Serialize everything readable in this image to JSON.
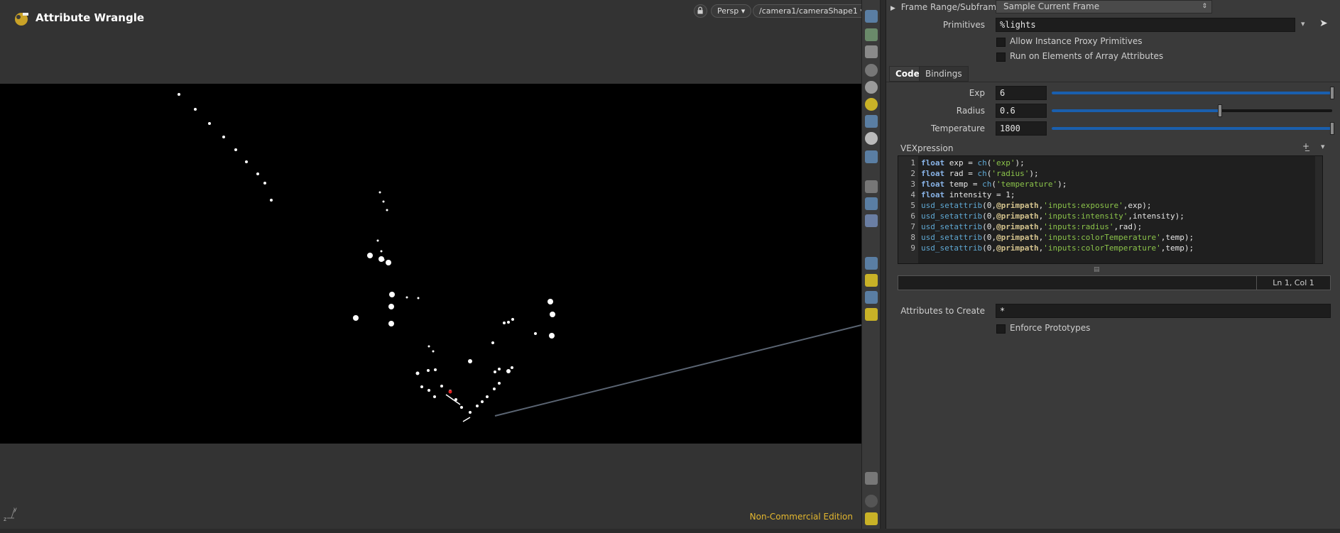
{
  "viewport": {
    "title": "Attribute Wrangle",
    "view_mode": "Persp",
    "camera_path": "/camera1/cameraShape1",
    "edition_badge": "Non-Commercial Edition",
    "icons": [
      "node-logo-icon",
      "lock-icon",
      "axis-gizmo-icon"
    ]
  },
  "toolbar": {
    "icons": [
      "select-icon",
      "transform-icon",
      "lock-icon",
      "close-icon",
      "sphere-icon",
      "light-icon",
      "camera-icon",
      "render-icon",
      "pose-icon",
      "display-icon",
      "info-icon",
      "grid-icon"
    ]
  },
  "panel": {
    "frame_range_label": "Frame Range/Subframes",
    "frame_range_value": "Sample Current Frame",
    "primitives_label": "Primitives",
    "primitives_value": "%lights",
    "allow_instance_label": "Allow Instance Proxy Primitives",
    "run_on_elements_label": "Run on Elements of Array Attributes",
    "tabs": [
      {
        "label": "Code",
        "active": true
      },
      {
        "label": "Bindings",
        "active": false
      }
    ],
    "params": [
      {
        "label": "Exp",
        "value": "6",
        "fraction": 1.0
      },
      {
        "label": "Radius",
        "value": "0.6",
        "fraction": 0.6
      },
      {
        "label": "Temperature",
        "value": "1800",
        "fraction": 1.0
      }
    ],
    "vexpression_label": "VEXpression",
    "code_lines": [
      "float exp = ch('exp');",
      "float rad = ch('radius');",
      "float temp = ch('temperature');",
      "float intensity = 1;",
      "usd_setattrib(0,@primpath,'inputs:exposure',exp);",
      "usd_setattrib(0,@primpath,'inputs:intensity',intensity);",
      "usd_setattrib(0,@primpath,'inputs:radius',rad);",
      "usd_setattrib(0,@primpath,'inputs:colorTemperature',temp);",
      "usd_setattrib(0,@primpath,'inputs:colorTemperature',temp);"
    ],
    "line_numbers": [
      "1",
      "2",
      "3",
      "4",
      "5",
      "6",
      "7",
      "8",
      "9"
    ],
    "cursor_position": "Ln 1, Col 1",
    "attributes_to_create_label": "Attributes to Create",
    "attributes_to_create_value": "*",
    "enforce_prototypes_label": "Enforce Prototypes"
  },
  "colors": {
    "accent": "#1a5fae",
    "edition": "#e3b72f",
    "background": "#3a3a3a"
  }
}
